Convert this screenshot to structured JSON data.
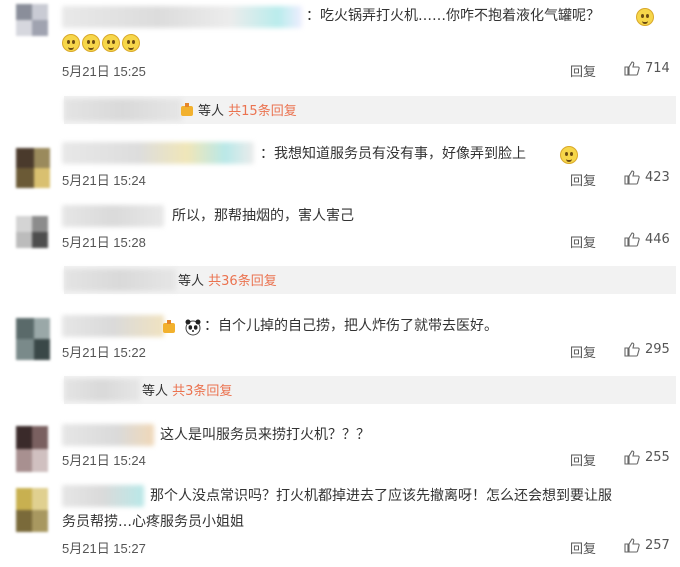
{
  "like_icon": "thumbs-up-icon",
  "reply_label": "回复",
  "comments": [
    {
      "text": "：吃火锅弄打火机……你咋不抱着液化气罐呢？",
      "time": "5月21日 15:25",
      "likes": "714"
    },
    {
      "text": "：我想知道服务员有没有事，好像弄到脸上",
      "time": "5月21日 15:24",
      "likes": "423"
    },
    {
      "text": "所以，那帮抽烟的，害人害己",
      "time": "5月21日 15:28",
      "likes": "446"
    },
    {
      "text": "：自个儿掉的自己捞，把人炸伤了就带去医好。",
      "time": "5月21日 15:22",
      "likes": "295"
    },
    {
      "text": "这人是叫服务员来捞打火机？？？",
      "time": "5月21日 15:24",
      "likes": "255"
    },
    {
      "text_line1": "那个人没点常识吗？打火机都掉进去了应该先撤离呀！怎么还会想到要让服",
      "text_line2": "务员帮捞…心疼服务员小姐姐",
      "time": "5月21日 15:27",
      "likes": "257"
    }
  ],
  "sub_replies": [
    {
      "prefix": "等人",
      "count": "共15条回复"
    },
    {
      "prefix": "等人",
      "count": "共36条回复"
    },
    {
      "prefix": "等人",
      "count": "共3条回复"
    }
  ]
}
